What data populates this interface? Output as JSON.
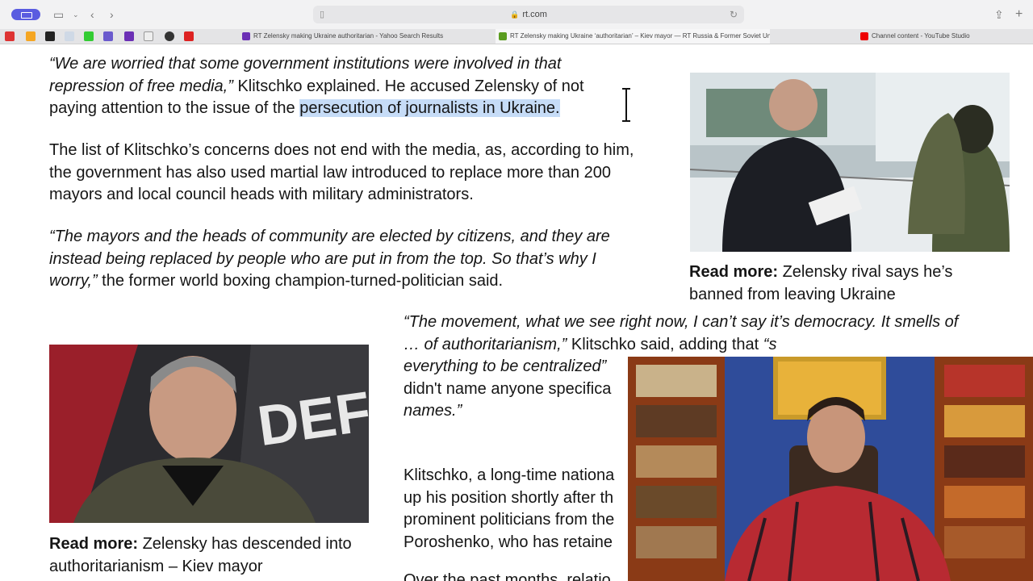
{
  "browser": {
    "url": "rt.com",
    "tabs": [
      {
        "title": "RT Zelensky making Ukraine authoritarian - Yahoo Search Results",
        "active": false
      },
      {
        "title": "RT Zelensky making Ukraine ‘authoritarian’ – Kiev mayor — RT Russia & Former Soviet Un...",
        "active": true
      },
      {
        "title": "Channel content - YouTube Studio",
        "active": false
      }
    ]
  },
  "article": {
    "p1_quote": "“We are worried that some government institutions were involved in that repression of free media,”",
    "p1_text_a": " Klitschko explained. He accused Zelensky of not paying attention to the issue of the ",
    "p1_highlight": "persecution of journalists in Ukraine.",
    "p2": "The list of Klitschko’s concerns does not end with the media, as, according to him, the government has also used martial law introduced to replace more than 200 mayors and local council heads with military administrators.",
    "p3_quote": "“The mayors and the heads of community are elected by citizens, and they are instead being replaced by people who are put in from the top. So that’s why I worry,”",
    "p3_text": " the former world boxing champion-turned-politician said.",
    "p4_quote_a": "“The movement, what we see right now, I can’t say it’s democracy. It smells of … of authoritarianism,”",
    "p4_text_a": " Klitschko said, adding that ",
    "p4_quote_b": "“s",
    "p4_quote_c": "everything to be centralized”",
    "p4_text_b": "didn't name anyone specifica",
    "p4_quote_d": "names.”",
    "p5": "Klitschko, a long-time nationa up his position shortly after th prominent politicians from the Poroshenko, who has retaine",
    "p6": "Over the past months, relatio"
  },
  "captions": {
    "right_label": "Read more:",
    "right_text": " Zelensky rival says he’s banned from leaving Ukraine",
    "left_label": "Read more:",
    "left_text": " Zelensky has descended into authoritarianism – Kiev mayor"
  },
  "colors": {
    "selection": "#c6dcf7",
    "tab_pill": "#5a5ce0"
  }
}
